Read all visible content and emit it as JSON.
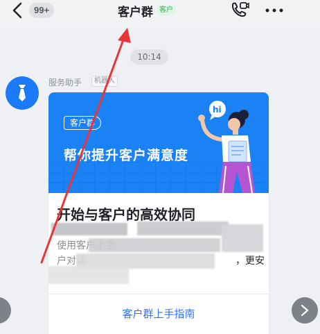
{
  "header": {
    "unread_count": "99+",
    "title": "客户群",
    "title_tag": "客户"
  },
  "chat": {
    "timestamp": "10:14",
    "sender_name": "服务助手",
    "sender_tag": "机器人"
  },
  "card": {
    "banner_chip": "客户群",
    "banner_headline": "帮你提升客户满意度",
    "title": "开始与客户的高效协同",
    "body_line1": "使用客户上手",
    "body_line2": "户对话",
    "body_line2_tail": "，更安",
    "guide_link": "客户群上手指南"
  },
  "colors": {
    "accent_blue": "#1a82f5",
    "link_blue": "#3370ff",
    "customer_tag_green": "#2fae5a",
    "annotation_red": "#e8353a"
  },
  "icons": {
    "back": "chevron-left-icon",
    "call": "video-call-icon",
    "more": "more-dots-icon",
    "avatar": "tie-icon",
    "next": "chevron-right-icon"
  }
}
